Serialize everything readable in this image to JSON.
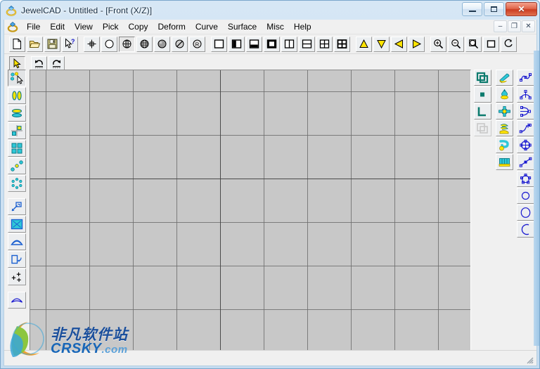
{
  "window": {
    "app_name": "JewelCAD",
    "document": "Untitled",
    "view": "[Front (X/Z)]",
    "title": "JewelCAD - Untitled - [Front (X/Z)]",
    "icon": "jewel-ring-icon",
    "buttons": {
      "minimize": "minimize-icon",
      "maximize": "maximize-icon",
      "close": "✕"
    },
    "mdi_buttons": {
      "minimize": "–",
      "restore": "❐",
      "close": "✕"
    }
  },
  "menu": {
    "icon": "jewel-ring-icon",
    "items": [
      {
        "label": "File"
      },
      {
        "label": "Edit"
      },
      {
        "label": "View"
      },
      {
        "label": "Pick"
      },
      {
        "label": "Copy"
      },
      {
        "label": "Deform"
      },
      {
        "label": "Curve"
      },
      {
        "label": "Surface"
      },
      {
        "label": "Misc"
      },
      {
        "label": "Help"
      }
    ]
  },
  "toolbar_main": {
    "groups": [
      {
        "name": "file-group",
        "buttons": [
          {
            "icon": "new-document-icon",
            "tip": "New"
          },
          {
            "icon": "open-folder-icon",
            "tip": "Open"
          },
          {
            "icon": "save-disk-icon",
            "tip": "Save"
          },
          {
            "icon": "help-pointer-icon",
            "tip": "Context Help"
          }
        ]
      },
      {
        "name": "render-group",
        "buttons": [
          {
            "icon": "wireframe-point-icon",
            "tip": "Points"
          },
          {
            "icon": "wireframe-circle-icon",
            "tip": "Wireframe"
          },
          {
            "icon": "mesh-globe-icon",
            "tip": "Mesh"
          },
          {
            "icon": "mesh-dense-globe-icon",
            "tip": "Dense Mesh"
          },
          {
            "icon": "shaded-sphere-icon",
            "tip": "Shaded"
          },
          {
            "icon": "shaded-sphere-alt-icon",
            "tip": "Shaded Alt"
          },
          {
            "icon": "render-sphere-icon",
            "tip": "Render"
          }
        ]
      },
      {
        "name": "view-layout-group",
        "buttons": [
          {
            "icon": "view-single-icon",
            "tip": "Single View"
          },
          {
            "icon": "view-left-half-icon",
            "tip": "Left Pane"
          },
          {
            "icon": "view-bottom-half-icon",
            "tip": "Bottom Pane"
          },
          {
            "icon": "view-filled-icon",
            "tip": "Filled View"
          },
          {
            "icon": "view-vsplit-icon",
            "tip": "Vertical Split"
          },
          {
            "icon": "view-hsplit-icon",
            "tip": "Horizontal Split"
          },
          {
            "icon": "view-quad-icon",
            "tip": "Four Views"
          },
          {
            "icon": "view-quad-bold-icon",
            "tip": "Four Views Bold"
          }
        ]
      },
      {
        "name": "rotate-group",
        "buttons": [
          {
            "icon": "triangle-up-icon",
            "tip": "Rotate Up"
          },
          {
            "icon": "triangle-down-icon",
            "tip": "Rotate Down"
          },
          {
            "icon": "triangle-left-icon",
            "tip": "Rotate Left"
          },
          {
            "icon": "triangle-right-icon",
            "tip": "Rotate Right"
          }
        ]
      },
      {
        "name": "zoom-group",
        "buttons": [
          {
            "icon": "zoom-in-icon",
            "tip": "Zoom In"
          },
          {
            "icon": "zoom-out-icon",
            "tip": "Zoom Out"
          },
          {
            "icon": "zoom-window-icon",
            "tip": "Zoom Window"
          },
          {
            "icon": "zoom-extents-icon",
            "tip": "Zoom Extents"
          },
          {
            "icon": "zoom-previous-icon",
            "tip": "Previous View"
          }
        ]
      }
    ]
  },
  "toolbar_second": {
    "buttons": [
      {
        "icon": "select-arrow-icon",
        "tip": "Select",
        "pressed": true
      },
      {
        "icon": "undo-icon",
        "tip": "Undo",
        "pressed": false
      },
      {
        "icon": "redo-icon",
        "tip": "Redo",
        "pressed": false
      }
    ]
  },
  "left_toolbar": {
    "groups": [
      {
        "name": "pick-group",
        "buttons": [
          {
            "icon": "pick-object-icon",
            "tip": "Pick Object",
            "pressed": true
          },
          {
            "icon": "pick-two-shapes-icon",
            "tip": "Pick Pair"
          },
          {
            "icon": "pick-stacked-icon",
            "tip": "Pick Stacked"
          },
          {
            "icon": "pick-quadrant-icon",
            "tip": "Pick Quadrant"
          },
          {
            "icon": "pick-grid-icon",
            "tip": "Pick Grid"
          },
          {
            "icon": "pick-diagonal-icon",
            "tip": "Pick Diagonal"
          },
          {
            "icon": "pick-ring-icon",
            "tip": "Pick Ring"
          }
        ]
      },
      {
        "name": "transform-group",
        "buttons": [
          {
            "icon": "scale-arrow-icon",
            "tip": "Scale"
          },
          {
            "icon": "select-rect-icon",
            "tip": "Rectangle Select",
            "pressed": false
          },
          {
            "icon": "dome-surface-icon",
            "tip": "Dome"
          },
          {
            "icon": "flip-icon",
            "tip": "Flip"
          },
          {
            "icon": "control-points-icon",
            "tip": "Control Points"
          }
        ]
      },
      {
        "name": "curve-group",
        "buttons": [
          {
            "icon": "arc-curve-icon",
            "tip": "Arc Curve"
          }
        ]
      }
    ]
  },
  "right_toolbar": {
    "column_1": {
      "name": "layer-column",
      "buttons": [
        {
          "icon": "layers-stack-icon",
          "tip": "Layers"
        },
        {
          "icon": "layer-single-icon",
          "tip": "Active Layer"
        },
        {
          "icon": "layer-corner-icon",
          "tip": "Layer Corner"
        },
        {
          "icon": "layers-ghost-icon",
          "tip": "Ghost Layers",
          "disabled": true
        }
      ]
    },
    "column_2": {
      "name": "solid-primitive-column",
      "buttons": [
        {
          "icon": "tube-shape-icon",
          "tip": "Tube"
        },
        {
          "icon": "bell-shape-icon",
          "tip": "Bell"
        },
        {
          "icon": "cross-bead-icon",
          "tip": "Cross Bead"
        },
        {
          "icon": "coil-shape-icon",
          "tip": "Coil"
        },
        {
          "icon": "spiral-shape-icon",
          "tip": "Spiral"
        },
        {
          "icon": "band-shape-icon",
          "tip": "Band"
        }
      ]
    },
    "column_3": {
      "name": "curve-tool-column",
      "buttons": [
        {
          "icon": "spline-curve-icon",
          "tip": "Spline"
        },
        {
          "icon": "arc-points-icon",
          "tip": "Arc by Points"
        },
        {
          "icon": "bezier-curve-icon",
          "tip": "Bezier"
        },
        {
          "icon": "tangent-curve-icon",
          "tip": "Tangent Curve"
        },
        {
          "icon": "circle-points-icon",
          "tip": "Circle by Points"
        },
        {
          "icon": "polyline-icon",
          "tip": "Polyline"
        },
        {
          "icon": "polygon-points-icon",
          "tip": "Polygon"
        },
        {
          "icon": "circle-icon",
          "tip": "Circle"
        },
        {
          "icon": "ellipse-icon",
          "tip": "Ellipse"
        },
        {
          "icon": "arc-icon",
          "tip": "Arc"
        }
      ]
    }
  },
  "canvas": {
    "name": "drawing-canvas",
    "view_label": "Front (X/Z)",
    "background_color": "#c8c8c8",
    "grid_color": "#6e6e6e",
    "grid_spacing_px": 62
  },
  "watermark": {
    "text_cn": "非凡软件站",
    "text_en": "CRSKY",
    "suffix": ".com"
  },
  "colors": {
    "aero_frame": "#cfe2f3",
    "client_bg": "#f0f0f0",
    "canvas_bg": "#c8c8c8",
    "teal": "#0c7b6e",
    "cyan": "#2ec8d8",
    "yellow": "#ffe400",
    "curve_blue": "#1a1ad0",
    "close_red": "#cc3d22"
  }
}
